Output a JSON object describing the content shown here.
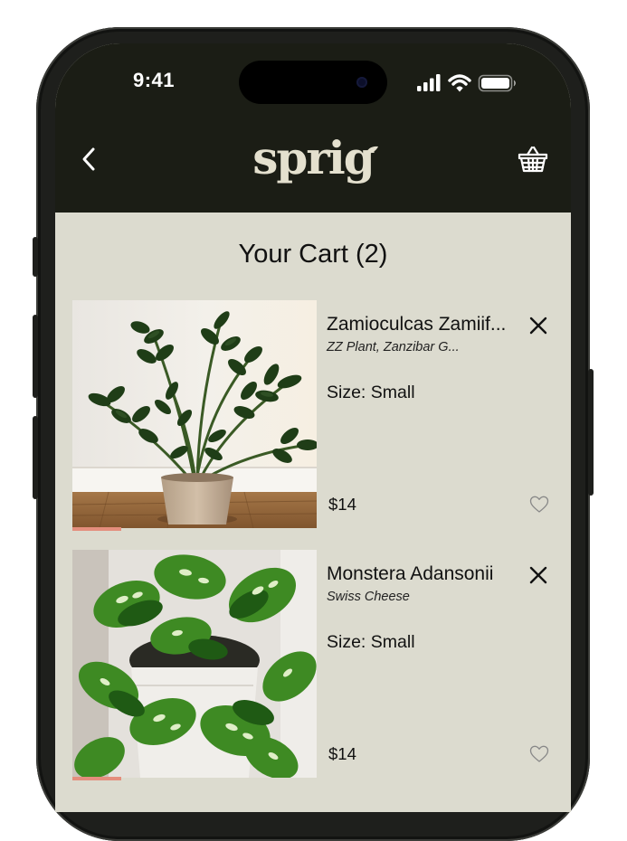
{
  "status_bar": {
    "time": "9:41",
    "signal_icon": "signal-bars-icon",
    "wifi_icon": "wifi-icon",
    "battery_icon": "battery-icon"
  },
  "header": {
    "back_icon": "chevron-left-icon",
    "logo": "sprig",
    "basket_icon": "basket-icon",
    "background": "#1b1d15",
    "logo_color": "#e4e0ce"
  },
  "page": {
    "background": "#dcdbcf",
    "title": "Your Cart (2)"
  },
  "cart": {
    "items": [
      {
        "name": "Zamioculcas Zamiif...",
        "alt_name": "ZZ Plant, Zanzibar G...",
        "size": "Size: Small",
        "price": "$14",
        "image": "zz-plant-photo",
        "image_progress": 0.2
      },
      {
        "name": "Monstera Adansonii",
        "alt_name": "Swiss Cheese",
        "size": "Size: Small",
        "price": "$14",
        "image": "monstera-adansonii-photo",
        "image_progress": 0.2
      }
    ],
    "remove_icon": "close-icon",
    "favorite_icon": "heart-outline-icon",
    "progress_color": "#e48e7d"
  }
}
